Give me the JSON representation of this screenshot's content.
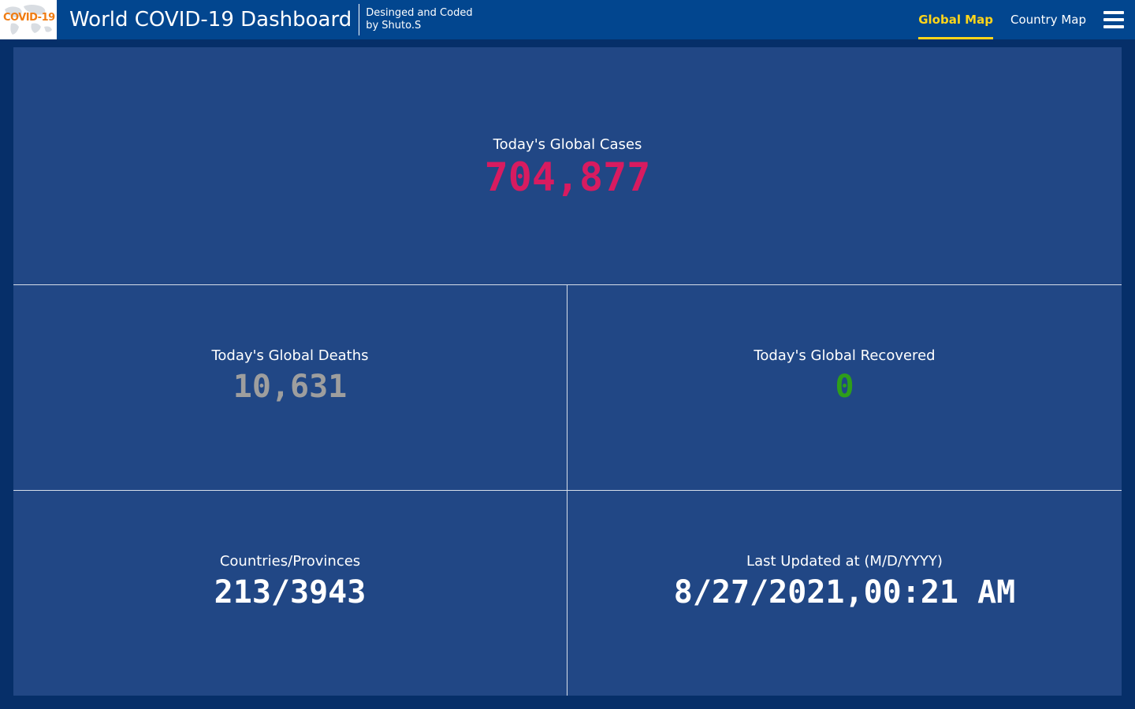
{
  "header": {
    "logo_text": "COVID-19",
    "title": "World COVID-19 Dashboard",
    "credit_line1": "Desinged and Coded",
    "credit_line2": "by Shuto.S",
    "nav": [
      {
        "label": "Global Map",
        "active": true
      },
      {
        "label": "Country Map",
        "active": false
      }
    ]
  },
  "stats": {
    "cases": {
      "label": "Today's Global Cases",
      "value": "704,877",
      "color": "#d81b60"
    },
    "deaths": {
      "label": "Today's Global Deaths",
      "value": "10,631",
      "color": "#9e9e9e"
    },
    "recovered": {
      "label": "Today's Global Recovered",
      "value": "0",
      "color": "#2e9e1a"
    },
    "countries": {
      "label": "Countries/Provinces",
      "value": "213/3943"
    },
    "updated": {
      "label": "Last Updated at (M/D/YYYY)",
      "value": "8/27/2021,00:21 AM"
    }
  },
  "colors": {
    "accent": "#ffd51a",
    "header_bg": "#02468f",
    "panel_bg": "#214785",
    "page_bg": "#062f69"
  },
  "icons": {
    "menu": "hamburger-menu-icon",
    "logo": "covid-19-logo"
  }
}
